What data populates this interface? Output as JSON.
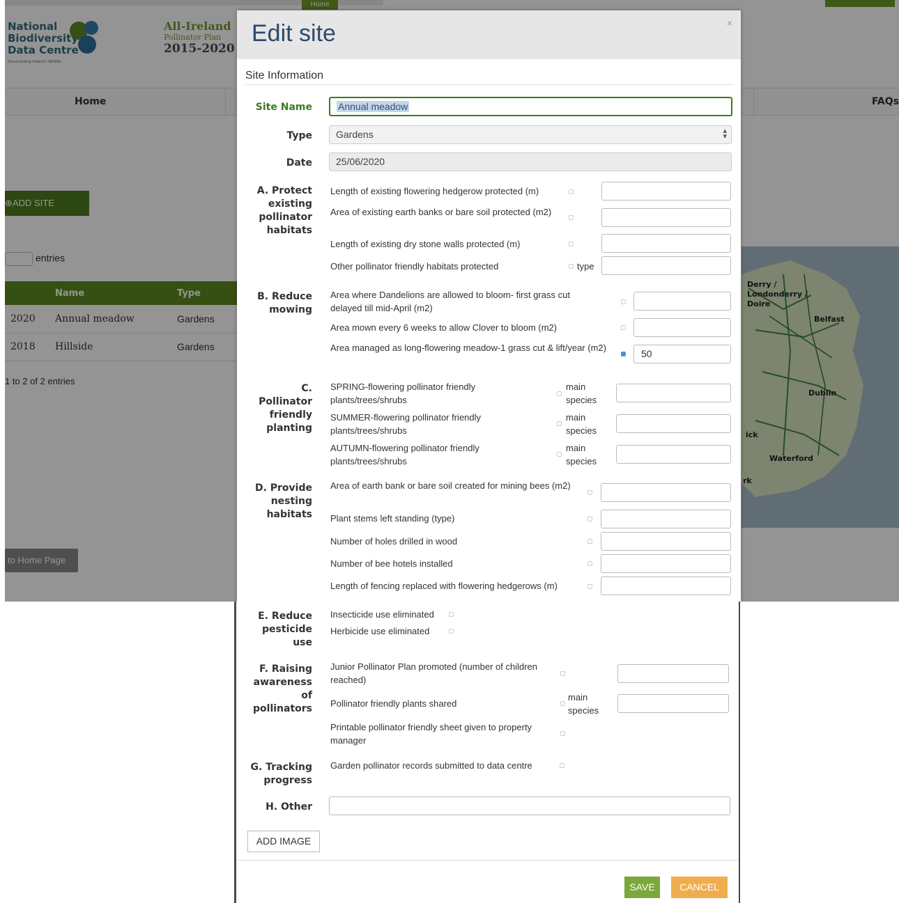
{
  "background": {
    "home_tag": "Home",
    "logo1_lines": [
      "National",
      "Biodiversity",
      "Data Centre"
    ],
    "logo1_sub": "Documenting Ireland's Wildlife",
    "logo2_lines": [
      "All-Ireland",
      "Pollinator Plan",
      "2015-2020"
    ],
    "nav_home": "Home",
    "nav_faq": "FAQs",
    "add_site": "ADD SITE",
    "entries_label": "entries",
    "table_headers": [
      "",
      "Name",
      "Type"
    ],
    "table_rows": [
      [
        "2020",
        "Annual meadow",
        "Gardens"
      ],
      [
        "2018",
        "Hillside",
        "Gardens"
      ]
    ],
    "showing": "1 to 2 of 2 entries",
    "back_button": "to Home Page",
    "map_labels": {
      "derry": "Derry /",
      "londonderry": "Londonderry /",
      "doire": "Doire",
      "belfast": "Belfast",
      "dublin": "Dublin",
      "limerick": "ick",
      "waterford": "Waterford",
      "cork": "rk"
    }
  },
  "modal": {
    "title": "Edit site",
    "close": "×",
    "section": "Site Information",
    "site_name_label": "Site Name",
    "site_name_value": "Annual meadow",
    "type_label": "Type",
    "type_value": "Gardens",
    "date_label": "Date",
    "date_value": "25/06/2020",
    "groups": {
      "a": {
        "label_lines": [
          "A. Protect",
          "existing",
          "pollinator",
          "habitats"
        ],
        "items": [
          "Length of existing flowering hedgerow protected (m)",
          "Area of existing earth banks or bare soil protected (m2)",
          "Length of existing dry stone walls protected (m)",
          "Other pollinator friendly habitats protected"
        ],
        "type_suffix": "type"
      },
      "b": {
        "label_lines": [
          "B. Reduce",
          "mowing"
        ],
        "items": [
          "Area where Dandelions are allowed to bloom- first grass cut delayed till mid-April (m2)",
          "Area mown every 6 weeks to allow Clover to bloom (m2)",
          "Area managed as long-flowering meadow-1 grass cut & lift/year (m2)"
        ],
        "meadow_value": "50"
      },
      "c": {
        "label_lines": [
          "C.",
          "Pollinator",
          "friendly",
          "planting"
        ],
        "items": [
          "SPRING-flowering pollinator friendly plants/trees/shrubs",
          "SUMMER-flowering pollinator friendly plants/trees/shrubs",
          "AUTUMN-flowering pollinator friendly plants/trees/shrubs"
        ],
        "species_suffix": [
          "main",
          "species"
        ]
      },
      "d": {
        "label_lines": [
          "D. Provide",
          "nesting",
          "habitats"
        ],
        "items": [
          "Area of earth bank or bare soil created for mining bees (m2)",
          "Plant stems left standing (type)",
          "Number of holes drilled in wood",
          "Number of bee hotels installed",
          "Length of fencing replaced with flowering hedgerows (m)"
        ]
      },
      "e": {
        "label_lines": [
          "E. Reduce",
          "pesticide",
          "use"
        ],
        "items": [
          "Insecticide use eliminated",
          "Herbicide use eliminated"
        ]
      },
      "f": {
        "label_lines": [
          "F. Raising",
          "awareness",
          "of",
          "pollinators"
        ],
        "items": [
          "Junior Pollinator Plan promoted (number of children reached)",
          "Pollinator friendly plants shared",
          "Printable pollinator friendly sheet given to property manager"
        ],
        "species_suffix": [
          "main",
          "species"
        ]
      },
      "g": {
        "label_lines": [
          "G. Tracking",
          "progress"
        ],
        "items": [
          "Garden pollinator records submitted to data centre"
        ]
      },
      "h": {
        "label": "H. Other"
      }
    },
    "add_image": "ADD IMAGE",
    "save": "SAVE",
    "cancel": "CANCEL"
  },
  "colors": {
    "accent_green": "#3d7a1e",
    "save": "#7aa83a",
    "cancel": "#f0ad4e",
    "title": "#2b4a6a",
    "checked": "#4a90e2"
  }
}
